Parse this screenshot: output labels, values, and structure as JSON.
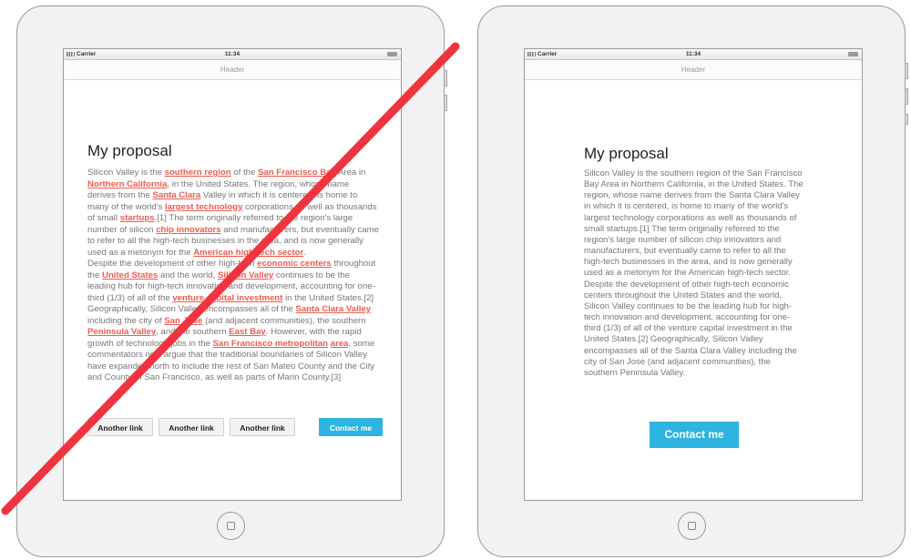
{
  "status_bar": {
    "carrier": "Carrier",
    "time": "11:34"
  },
  "header": {
    "title": "Header"
  },
  "left_mockup": {
    "title": "My proposal",
    "paragraph1": [
      {
        "t": "Silicon Valley is the "
      },
      {
        "t": "southern region",
        "link": true
      },
      {
        "t": " of the "
      },
      {
        "t": "San Francisco Bay",
        "link": true
      },
      {
        "t": " Area in "
      },
      {
        "t": "Northern California",
        "link": true
      },
      {
        "t": ", in the United States. The region, whose name derives from the "
      },
      {
        "t": "Santa Clara",
        "link": true
      },
      {
        "t": " Valley in which it is centered, is home to many of the world's "
      },
      {
        "t": "largest technology",
        "link": true
      },
      {
        "t": " corporations as well as thousands of small "
      },
      {
        "t": "startups",
        "link": true
      },
      {
        "t": ".[1] The term originally referred to the region's large number of silicon "
      },
      {
        "t": "chip innovators",
        "link": true
      },
      {
        "t": " and manufacturers, but eventually came to refer to all the high-tech businesses in the area, and is now generally used as a metonym for the "
      },
      {
        "t": "American high-tech sector",
        "link": true
      },
      {
        "t": "."
      }
    ],
    "paragraph2": [
      {
        "t": "Despite the development of other high-tech "
      },
      {
        "t": "economic centers",
        "link": true
      },
      {
        "t": " throughout the "
      },
      {
        "t": "United States",
        "link": true
      },
      {
        "t": " and the world, "
      },
      {
        "t": "Silicon Valley",
        "link": true
      },
      {
        "t": " continues to be the leading hub for high-tech innovation and development, accounting for one-third (1/3) of all of the "
      },
      {
        "t": "venture capital investment",
        "link": true
      },
      {
        "t": " in the United States.[2] Geographically, Silicon Valley encompasses all of the "
      },
      {
        "t": "Santa Clara Valley",
        "link": true
      },
      {
        "t": " including the city of "
      },
      {
        "t": "San Jose",
        "link": true
      },
      {
        "t": " (and adjacent communities), the southern "
      },
      {
        "t": "Peninsula Valley",
        "link": true
      },
      {
        "t": ", and the southern "
      },
      {
        "t": "East Bay",
        "link": true
      },
      {
        "t": ". However, with the rapid growth of technology jobs in the "
      },
      {
        "t": "San Francisco metropolitan",
        "link": true
      },
      {
        "t": " "
      },
      {
        "t": "area",
        "link": true
      },
      {
        "t": ", some commentators now argue that the traditional boundaries of Silicon Valley have expanded north to include the rest of San Mateo County and the City and County of San Francisco, as well as parts of Marin County.[3]"
      }
    ],
    "buttons": [
      "Another link",
      "Another link",
      "Another link"
    ],
    "contact": "Contact me"
  },
  "right_mockup": {
    "title": "My proposal",
    "paragraph1": "Silicon Valley is the southern region of the San Francisco Bay Area in Northern California, in the United States. The region, whose name derives from the Santa Clara Valley in which it is centered, is home to many of the world's largest technology corporations as well as thousands of small startups.[1] The term originally referred to the region's large number of silicon chip innovators and manufacturers, but eventually came to refer to all the high-tech businesses in the area, and is now generally used as a metonym for the American high-tech sector.",
    "paragraph2": "Despite the development of other high-tech economic centers throughout the United States and the world, Silicon Valley continues to be the leading hub for high-tech innovation and development, accounting for one-third (1/3) of all of the venture capital investment in the United States.[2] Geographically, Silicon Valley encompasses all of the Santa Clara Valley including the city of San Jose (and adjacent communities), the southern Peninsula Valley.",
    "contact": "Contact me"
  },
  "colors": {
    "link": "#ee5b4f",
    "contact_button": "#2eb4e0",
    "strike_line": "#f0343f"
  }
}
